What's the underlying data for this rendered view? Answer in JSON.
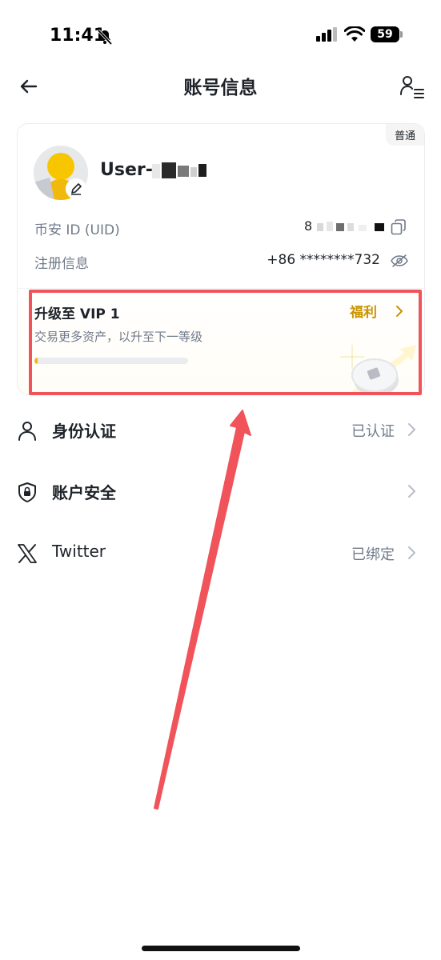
{
  "status_bar": {
    "time": "11:41",
    "battery": "59"
  },
  "header": {
    "title": "账号信息",
    "icons": {
      "back": "arrow-left-icon",
      "profile": "user-list-icon"
    }
  },
  "account": {
    "tier_badge": "普通",
    "username": "User-",
    "uid_label": "币安 ID (UID)",
    "uid_value": "8",
    "registration_label": "注册信息",
    "phone": "+86 ********732"
  },
  "vip": {
    "title": "升级至 VIP 1",
    "benefit_label": "福利",
    "description": "交易更多资产，以升至下一等级",
    "progress": 0.02,
    "accent_color": "#F0B90B"
  },
  "menu": [
    {
      "label": "身份认证",
      "status": "已认证",
      "icon": "person-icon"
    },
    {
      "label": "账户安全",
      "status": "",
      "icon": "shield-lock-icon"
    },
    {
      "label": "Twitter",
      "status": "已绑定",
      "icon": "x-logo-icon"
    }
  ],
  "colors": {
    "annotation": "#F0545A",
    "benefit": "#C99400",
    "secondary_text": "#707A8A"
  }
}
